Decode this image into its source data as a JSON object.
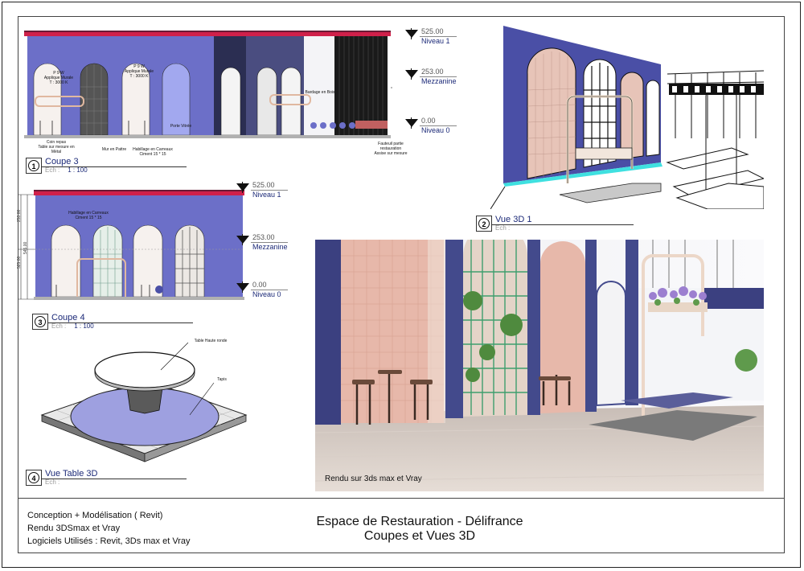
{
  "coupe3": {
    "annotations": {
      "lampe_left": "P 9 W\nApplique Murale\nT : 3000 K",
      "lampe_right": "P 9 W\nApplique Murale\nT : 3000 K",
      "coin_repas": "Coin repas\nTable sur mesure en\nMétal",
      "mur_pattre": "Mur en Pattre",
      "habillage": "Habillage en Carreaux\nCiment 15 * 15",
      "porte_vitree": "Porte Vitrée",
      "bardage": "Bardage en Bois",
      "fauteuil": "Fauteuil partie\nrestauration\nAssise sur mesure"
    },
    "levels": [
      {
        "value": "525.00",
        "name": "Niveau 1"
      },
      {
        "value": "253.00",
        "name": "Mezzanine"
      },
      {
        "value": "0.00",
        "name": "Niveau 0"
      }
    ],
    "title": {
      "number": "1",
      "name": "Coupe 3",
      "ech_label": "Ech :",
      "ech_value": "1 : 100"
    }
  },
  "coupe4": {
    "annotations": {
      "habillage": "Habillage en Carreaux\nCiment 15 * 15"
    },
    "dims": [
      "253.00",
      "525.00",
      "545.00"
    ],
    "levels": [
      {
        "value": "525.00",
        "name": "Niveau 1"
      },
      {
        "value": "253.00",
        "name": "Mezzanine"
      },
      {
        "value": "0.00",
        "name": "Niveau 0"
      }
    ],
    "title": {
      "number": "3",
      "name": "Coupe 4",
      "ech_label": "Ech :",
      "ech_value": "1 : 100"
    }
  },
  "vue3d1": {
    "title": {
      "number": "2",
      "name": "Vue 3D 1",
      "ech_label": "Ech :"
    }
  },
  "table3d": {
    "annotations": {
      "table": "Table Haute ronde",
      "tapis": "Tapis"
    },
    "title": {
      "number": "4",
      "name": "Vue Table 3D",
      "ech_label": "Ech :"
    }
  },
  "render": {
    "caption": "Rendu sur 3ds max et Vray"
  },
  "footer": {
    "line1": "Conception + Modélisation ( Revit)",
    "line2": "Rendu 3DSmax et Vray",
    "line3": "Logiciels Utilisés : Revit, 3Ds max et Vray",
    "title1": "Espace de Restauration - Délifrance",
    "title2": "Coupes et Vues 3D"
  },
  "colors": {
    "wall_blue": "#6c6fc8",
    "dark_navy": "#3a3f8f",
    "accent_pink": "#d0204a",
    "text_blue": "#1c2a78",
    "tile_pink": "#e6b4a6",
    "floor_wood": "#d8ccc4"
  }
}
